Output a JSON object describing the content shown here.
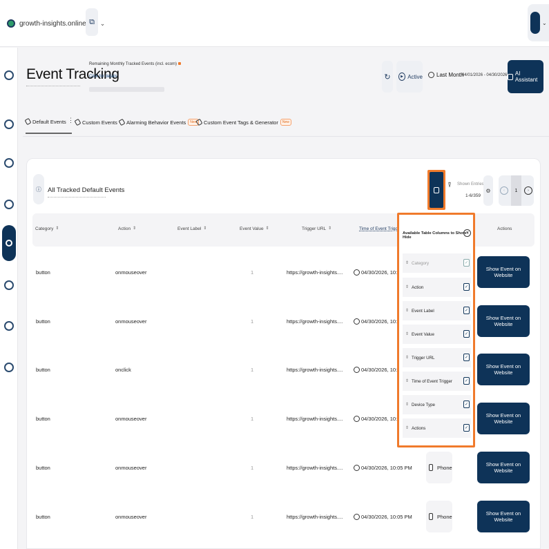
{
  "topbar": {
    "site": "growth-insights.online",
    "site_chevron": "⌄",
    "external_icon": "⧉",
    "avatar_chevron": "⌄"
  },
  "sidebar": {
    "icons": [
      "timer-icon",
      "chart-icon",
      "bag-icon",
      "dash-icon",
      "events-icon",
      "chat-icon",
      "shield-icon",
      "gear-icon"
    ]
  },
  "header": {
    "title": "Event Tracking",
    "quota_label": "Remaining Monthly Tracked Events (incl. ecom)",
    "quota_link": "Click for details",
    "quota_fraction": 0.0,
    "refresh_icon": "↻",
    "active_label": "Active",
    "period_label": "Last Month",
    "date_range": "04/01/2026 - 04/30/2026",
    "date_chevron": "⌄",
    "ai_label": "AI Assistant"
  },
  "tabs": [
    {
      "label": "Default Events",
      "new": ""
    },
    {
      "label": "Custom Events",
      "new": ""
    },
    {
      "label": "Alarming Behavior Events",
      "new": "New"
    },
    {
      "label": "Custom Event Tags & Generator",
      "new": "New"
    }
  ],
  "card": {
    "title": "All Tracked Default Events",
    "shown_label": "Shown Entries",
    "shown_value": "1-6/359",
    "page": "1",
    "prev_icon": "‹",
    "next_icon": "›"
  },
  "table": {
    "headers": [
      "Category",
      "Action",
      "Event Label",
      "Event Value",
      "Trigger URL",
      "Time of Event Trigger",
      "Actions"
    ],
    "rows": [
      {
        "category": "button",
        "action": "onmouseover",
        "label": "",
        "value": "1",
        "url": "https://growth-insights....",
        "time": "04/30/2026, 10:09 P",
        "device": "",
        "button": "Show Event on Website"
      },
      {
        "category": "button",
        "action": "onmouseover",
        "label": "",
        "value": "1",
        "url": "https://growth-insights....",
        "time": "04/30/2026, 10:09 P",
        "device": "",
        "button": "Show Event on Website"
      },
      {
        "category": "button",
        "action": "onclick",
        "label": "",
        "value": "1",
        "url": "https://growth-insights....",
        "time": "04/30/2026, 10:09 P",
        "device": "",
        "button": "Show Event on Website"
      },
      {
        "category": "button",
        "action": "onmouseover",
        "label": "",
        "value": "1",
        "url": "https://growth-insights....",
        "time": "04/30/2026, 10:09 P",
        "device": "",
        "button": "Show Event on Website"
      },
      {
        "category": "button",
        "action": "onmouseover",
        "label": "",
        "value": "1",
        "url": "https://growth-insights....",
        "time": "04/30/2026, 10:05 PM",
        "device": "Phone",
        "button": "Show Event on Website"
      },
      {
        "category": "button",
        "action": "onmouseover",
        "label": "",
        "value": "1",
        "url": "https://growth-insights....",
        "time": "04/30/2026, 10:05 PM",
        "device": "Phone",
        "button": "Show Event on Website"
      }
    ]
  },
  "popup": {
    "title": "Available Table Columns to Show / Hide",
    "close_icon": "×",
    "check_mark": "✓",
    "items": [
      {
        "label": "Category",
        "disabled": true
      },
      {
        "label": "Action",
        "disabled": false
      },
      {
        "label": "Event Label",
        "disabled": false
      },
      {
        "label": "Event Value",
        "disabled": false
      },
      {
        "label": "Trigger URL",
        "disabled": false
      },
      {
        "label": "Time of Event Trigger",
        "disabled": false
      },
      {
        "label": "Device Type",
        "disabled": false
      },
      {
        "label": "Actions",
        "disabled": false
      }
    ]
  }
}
